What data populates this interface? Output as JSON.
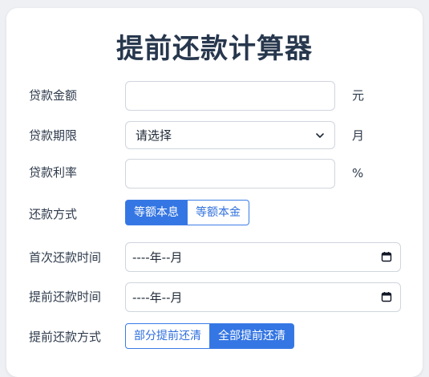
{
  "title": "提前还款计算器",
  "fields": {
    "loan_amount": {
      "label": "贷款金额",
      "value": "",
      "unit": "元"
    },
    "loan_term": {
      "label": "贷款期限",
      "selected": "请选择",
      "unit": "月"
    },
    "interest_rate": {
      "label": "贷款利率",
      "value": "",
      "unit": "%"
    },
    "repayment_method": {
      "label": "还款方式",
      "options": [
        "等额本息",
        "等额本金"
      ],
      "selected": "等额本息"
    },
    "first_repayment_date": {
      "label": "首次还款时间",
      "value": "----年--月"
    },
    "prepayment_date": {
      "label": "提前还款时间",
      "value": "----年--月"
    },
    "prepayment_method": {
      "label": "提前还款方式",
      "options": [
        "部分提前还清",
        "全部提前还清"
      ],
      "selected": "全部提前还清"
    }
  },
  "colors": {
    "accent": "#3476e3",
    "title": "#27374d",
    "card": "#ffffff",
    "background": "#eef0f4"
  },
  "icons": {
    "select": "chevron-down-icon",
    "date": "calendar-icon"
  }
}
